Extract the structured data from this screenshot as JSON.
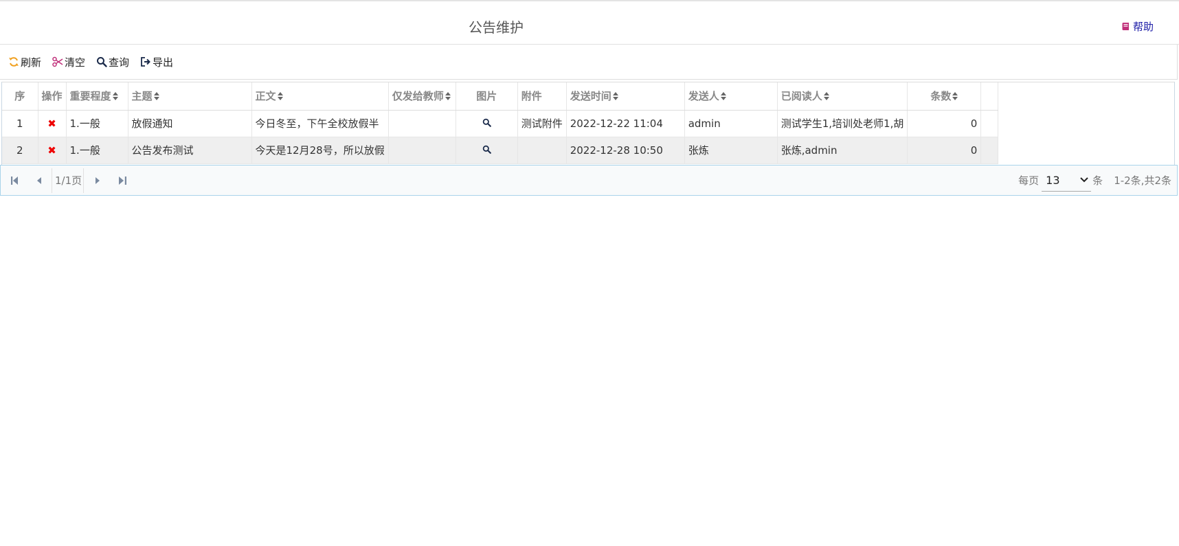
{
  "header": {
    "title": "公告维护",
    "help_label": "帮助"
  },
  "toolbar": {
    "refresh_label": "刷新",
    "clear_label": "清空",
    "query_label": "查询",
    "export_label": "导出"
  },
  "table": {
    "columns": [
      "序",
      "操作",
      "重要程度",
      "主题",
      "正文",
      "仅发给教师",
      "图片",
      "附件",
      "发送时间",
      "发送人",
      "已阅读人",
      "条数"
    ],
    "rows": [
      {
        "seq": "1",
        "importance": "1.一般",
        "subject": "放假通知",
        "body": "今日冬至，下午全校放假半",
        "teachers_only": "",
        "attachment": "测试附件",
        "send_time": "2022-12-22 11:04",
        "sender": "admin",
        "readers": "测试学生1,培训处老师1,胡",
        "count": "0"
      },
      {
        "seq": "2",
        "importance": "1.一般",
        "subject": "公告发布测试",
        "body": "今天是12月28号，所以放假",
        "teachers_only": "",
        "attachment": "",
        "send_time": "2022-12-28 10:50",
        "sender": "张炼",
        "readers": "张炼,admin",
        "count": "0"
      }
    ]
  },
  "pager": {
    "page_info": "1/1页",
    "per_page_label": "每页",
    "per_page_value": "13",
    "unit_label": "条",
    "summary": "1-2条,共2条"
  },
  "colors": {
    "refresh_icon": "#f0a020",
    "clear_icon": "#c0307a",
    "help_icon": "#c0307a",
    "delete_icon": "#e00000",
    "pager_border": "#a9d3ea"
  }
}
